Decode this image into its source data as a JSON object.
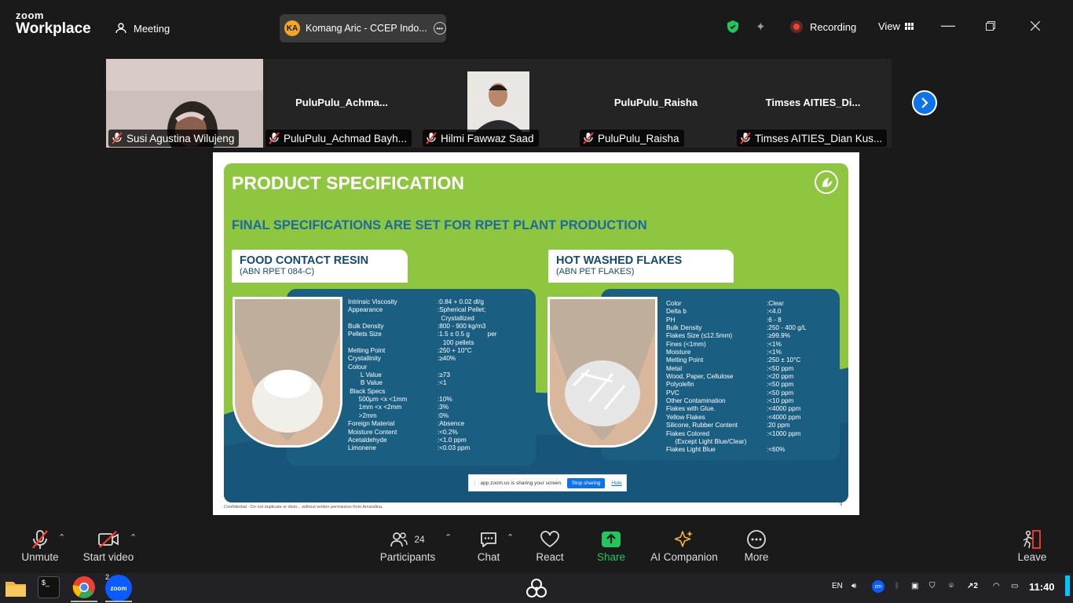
{
  "titlebar": {
    "brand_top": "zoom",
    "brand_bottom": "Workplace",
    "meeting_label": "Meeting",
    "host_initials": "KA",
    "host_name": "Komang Aric - CCEP Indo...",
    "recording_label": "Recording",
    "view_label": "View"
  },
  "participants": [
    {
      "name": "Susi Agustina Wilujeng",
      "display": "",
      "video": true
    },
    {
      "name": "PuluPulu_Achmad Bayh...",
      "display": "PuluPulu_Achma...",
      "video": false
    },
    {
      "name": "Hilmi Fawwaz Saad",
      "display": "",
      "video": true
    },
    {
      "name": "PuluPulu_Raisha",
      "display": "PuluPulu_Raisha",
      "video": false
    },
    {
      "name": "Timses AITIES_Dian Kus...",
      "display": "Timses AITIES_Di...",
      "video": false
    }
  ],
  "slide": {
    "title": "PRODUCT SPECIFICATION",
    "subtitle": "FINAL SPECIFICATIONS ARE SET FOR RPET PLANT PRODUCTION",
    "left": {
      "heading": "FOOD CONTACT RESIN",
      "code": "(ABN RPET 084-C)",
      "specs": [
        [
          "Intrinsic Viscosity",
          ":0.84 + 0.02 dl/g"
        ],
        [
          "Appearance",
          ":Spherical Pellet;"
        ],
        [
          "",
          "  Crystallized"
        ],
        [
          "Bulk Density",
          ":800 - 900 kg/m3"
        ],
        [
          "Pellets Size",
          ":1.5 ± 0.5 g          per"
        ],
        [
          "",
          "   100 pellets"
        ],
        [
          "Melting Point",
          ":250 + 10°C"
        ],
        [
          "Crystallinity",
          ":≥40%"
        ],
        [
          "Colour",
          ""
        ],
        [
          "       L Value",
          ":≥73"
        ],
        [
          "       B Value",
          ":<1"
        ],
        [
          " Black Specs",
          ""
        ],
        [
          "      500μm <x <1mm",
          ":10%"
        ],
        [
          "      1mm <x <2mm",
          ":3%"
        ],
        [
          "      >2mm",
          ":0%"
        ],
        [
          "Foreign Material",
          ":Absence"
        ],
        [
          "Moisture Content",
          ":<0.2%"
        ],
        [
          "Acetaldehyde",
          ":<1.0 ppm"
        ],
        [
          "Limonene",
          ":<0.03 ppm"
        ]
      ]
    },
    "right": {
      "heading": "HOT WASHED FLAKES",
      "code": "(ABN PET FLAKES)",
      "specs": [
        [
          "Color",
          ":Clear"
        ],
        [
          "Delta b",
          ":<4.0"
        ],
        [
          "PH",
          ":6 - 8"
        ],
        [
          "Bulk Density",
          ":250 - 400 g/L"
        ],
        [
          "Flakes Size (≤12.5mm)",
          ":≥99.9%"
        ],
        [
          "Fines (<1mm)",
          ":<1%"
        ],
        [
          "Moisture",
          ":<1%"
        ],
        [
          "Melting Point",
          ":250 ± 10°C"
        ],
        [
          "Metal",
          ":<50 ppm"
        ],
        [
          "Wood, Paper, Cellulose",
          ":<20 ppm"
        ],
        [
          "Polyolefin",
          ":<50 ppm"
        ],
        [
          "PVC",
          ":<50 ppm"
        ],
        [
          "Other Contamination",
          ":<10 ppm"
        ],
        [
          "Flakes with Glue.",
          ":<4000 ppm"
        ],
        [
          "Yellow Flakes",
          ":<4000 ppm"
        ],
        [
          "Silicone, Rubber Content",
          ":20 ppm"
        ],
        [
          "Flakes Colored",
          ":<1000 ppm"
        ],
        [
          "     (Except Light Blue/Clear)",
          ""
        ],
        [
          "Flakes Light Blue",
          ":<60%"
        ]
      ]
    },
    "share_notice": "app.zoom.us is sharing your screen.",
    "stop_sharing": "Stop sharing",
    "hide": "Hide",
    "footer": "Confidential - Do not duplicate or distri... without written permission from Amandina.",
    "page": "9"
  },
  "toolbar": {
    "unmute": "Unmute",
    "start_video": "Start video",
    "participants": "Participants",
    "participants_count": "24",
    "chat": "Chat",
    "react": "React",
    "share": "Share",
    "ai_companion": "AI Companion",
    "more": "More",
    "leave": "Leave"
  },
  "taskbar": {
    "zoom_badge": "2",
    "lang": "EN",
    "notif_count": "2",
    "clock": "11:40"
  },
  "colors": {
    "accent": "#0e72ed",
    "share_green": "#1fc46b",
    "slide_green": "#8ec63f",
    "slide_blue": "#1a5f82",
    "recording_red": "#ff3b30"
  }
}
